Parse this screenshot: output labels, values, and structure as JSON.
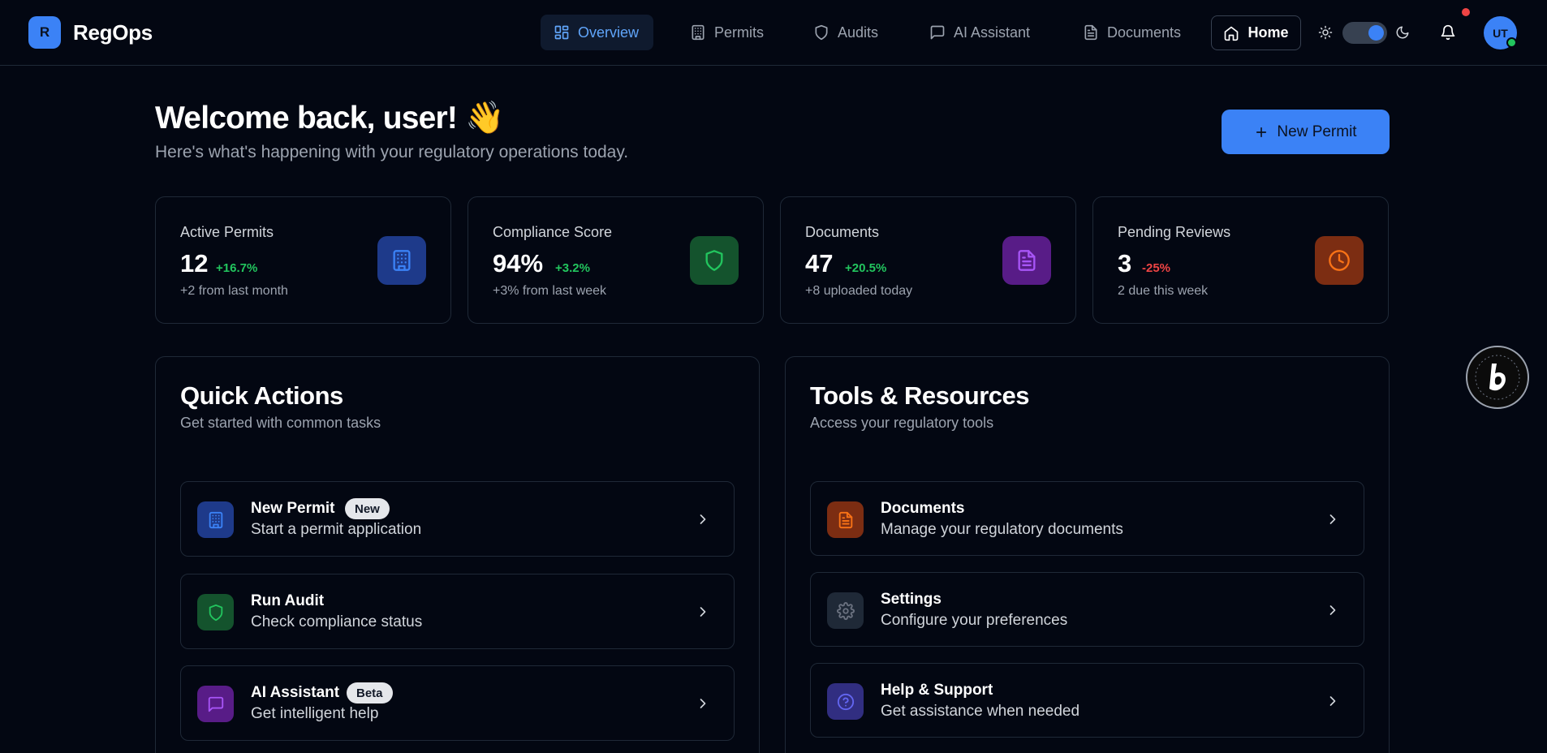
{
  "app": {
    "logo_letter": "R",
    "name": "RegOps"
  },
  "nav": {
    "items": [
      {
        "label": "Overview",
        "icon": "layout-grid-icon",
        "active": true
      },
      {
        "label": "Permits",
        "icon": "building-icon",
        "active": false
      },
      {
        "label": "Audits",
        "icon": "shield-icon",
        "active": false
      },
      {
        "label": "AI Assistant",
        "icon": "message-square-icon",
        "active": false
      },
      {
        "label": "Documents",
        "icon": "file-text-icon",
        "active": false
      }
    ],
    "home_label": "Home"
  },
  "user": {
    "initials": "UT",
    "has_notifications": true,
    "online": true,
    "theme": "dark"
  },
  "welcome": {
    "title": "Welcome back, user! 👋",
    "subtitle": "Here's what's happening with your regulatory operations today.",
    "new_permit_label": "New Permit"
  },
  "stats": [
    {
      "label": "Active Permits",
      "value": "12",
      "change": "+16.7%",
      "change_color": "#22c55e",
      "note": "+2 from last month",
      "icon": "building-icon",
      "icon_bg": "#1e3a8a",
      "icon_color": "#3b82f6"
    },
    {
      "label": "Compliance Score",
      "value": "94%",
      "change": "+3.2%",
      "change_color": "#22c55e",
      "note": "+3% from last week",
      "icon": "shield-icon",
      "icon_bg": "#14532d",
      "icon_color": "#22c55e"
    },
    {
      "label": "Documents",
      "value": "47",
      "change": "+20.5%",
      "change_color": "#22c55e",
      "note": "+8 uploaded today",
      "icon": "file-text-icon",
      "icon_bg": "#581c87",
      "icon_color": "#a855f7"
    },
    {
      "label": "Pending Reviews",
      "value": "3",
      "change": "-25%",
      "change_color": "#ef4444",
      "note": "2 due this week",
      "icon": "clock-icon",
      "icon_bg": "#7c2d12",
      "icon_color": "#f97316"
    }
  ],
  "quick_actions": {
    "title": "Quick Actions",
    "subtitle": "Get started with common tasks",
    "items": [
      {
        "title": "New Permit",
        "badge": "New",
        "desc": "Start a permit application",
        "icon": "building-icon",
        "icon_bg": "#1e3a8a",
        "icon_color": "#3b82f6"
      },
      {
        "title": "Run Audit",
        "badge": "",
        "desc": "Check compliance status",
        "icon": "shield-icon",
        "icon_bg": "#14532d",
        "icon_color": "#22c55e"
      },
      {
        "title": "AI Assistant",
        "badge": "Beta",
        "desc": "Get intelligent help",
        "icon": "message-square-icon",
        "icon_bg": "#581c87",
        "icon_color": "#a855f7"
      }
    ]
  },
  "tools": {
    "title": "Tools & Resources",
    "subtitle": "Access your regulatory tools",
    "items": [
      {
        "title": "Documents",
        "desc": "Manage your regulatory documents",
        "icon": "file-text-icon",
        "icon_bg": "#7c2d12",
        "icon_color": "#f97316"
      },
      {
        "title": "Settings",
        "desc": "Configure your preferences",
        "icon": "gear-icon",
        "icon_bg": "#1f2937",
        "icon_color": "#6b7280"
      },
      {
        "title": "Help & Support",
        "desc": "Get assistance when needed",
        "icon": "help-circle-icon",
        "icon_bg": "#312e81",
        "icon_color": "#6366f1"
      }
    ]
  }
}
